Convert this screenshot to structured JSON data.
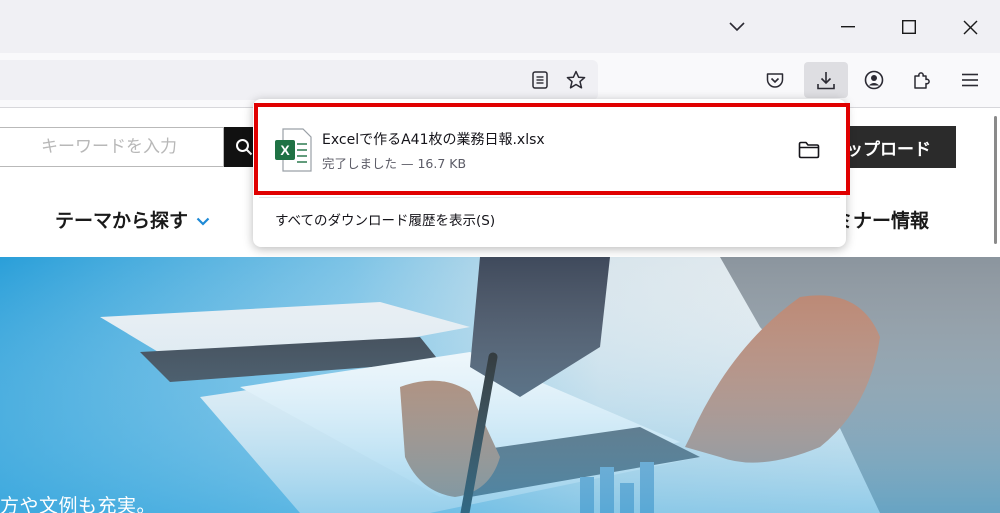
{
  "browser": {
    "tab_list_icon": "chevron-down-icon",
    "window_controls": {
      "minimize": "minimize-icon",
      "maximize": "maximize-icon",
      "close": "close-icon"
    },
    "urlbar_icons": [
      "reader-view-icon",
      "bookmark-star-icon"
    ],
    "toolbar_icons": [
      "pocket-icon",
      "download-icon",
      "account-icon",
      "extensions-icon",
      "menu-icon"
    ]
  },
  "page": {
    "search": {
      "placeholder": "キーワードを入力"
    },
    "upload_button": "ップロード",
    "nav": {
      "theme": "テーマから探す",
      "seminar": "ミナー情報"
    },
    "hero_caption": "方や文例も充実。"
  },
  "downloads": {
    "item": {
      "filename": "Excelで作るA41枚の業務日報.xlsx",
      "status": "完了しました — 16.7 KB",
      "file_icon": "excel-file-icon",
      "folder_icon": "folder-icon"
    },
    "show_all": "すべてのダウンロード履歴を表示(S)"
  },
  "colors": {
    "highlight": "#e00000",
    "excel_green": "#1f7244",
    "active_toolbar": "#dedee2",
    "accent_chevron": "#1e8ad6"
  }
}
